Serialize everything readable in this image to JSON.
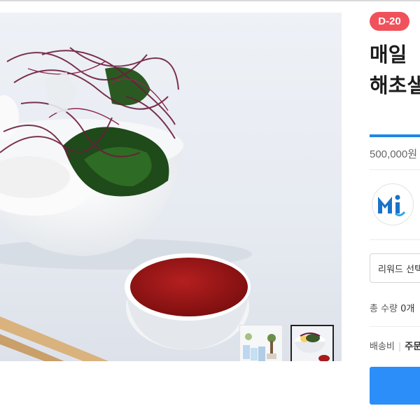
{
  "campaign": {
    "dday_badge": "D-20",
    "title_line1": "매일 ",
    "title_line2": "해초샐",
    "funding_progress": 1.0,
    "amount_text": "500,000원"
  },
  "maker": {
    "logo_text": "Mi"
  },
  "options": {
    "reward_select_label": "리워드 선택",
    "total_qty_label": "총 수량",
    "total_qty_value": "0개",
    "shipping_label": "배송비",
    "shipping_value": "주문"
  },
  "gallery": {
    "thumbnails": [
      "product-package-thumbnail",
      "salad-bowl-thumbnail"
    ],
    "selected_index": 1
  },
  "colors": {
    "badge": "#f0515b",
    "progress": "#1e88e5",
    "cta": "#2c8ef8",
    "logo_blue": "#1a73c9"
  }
}
